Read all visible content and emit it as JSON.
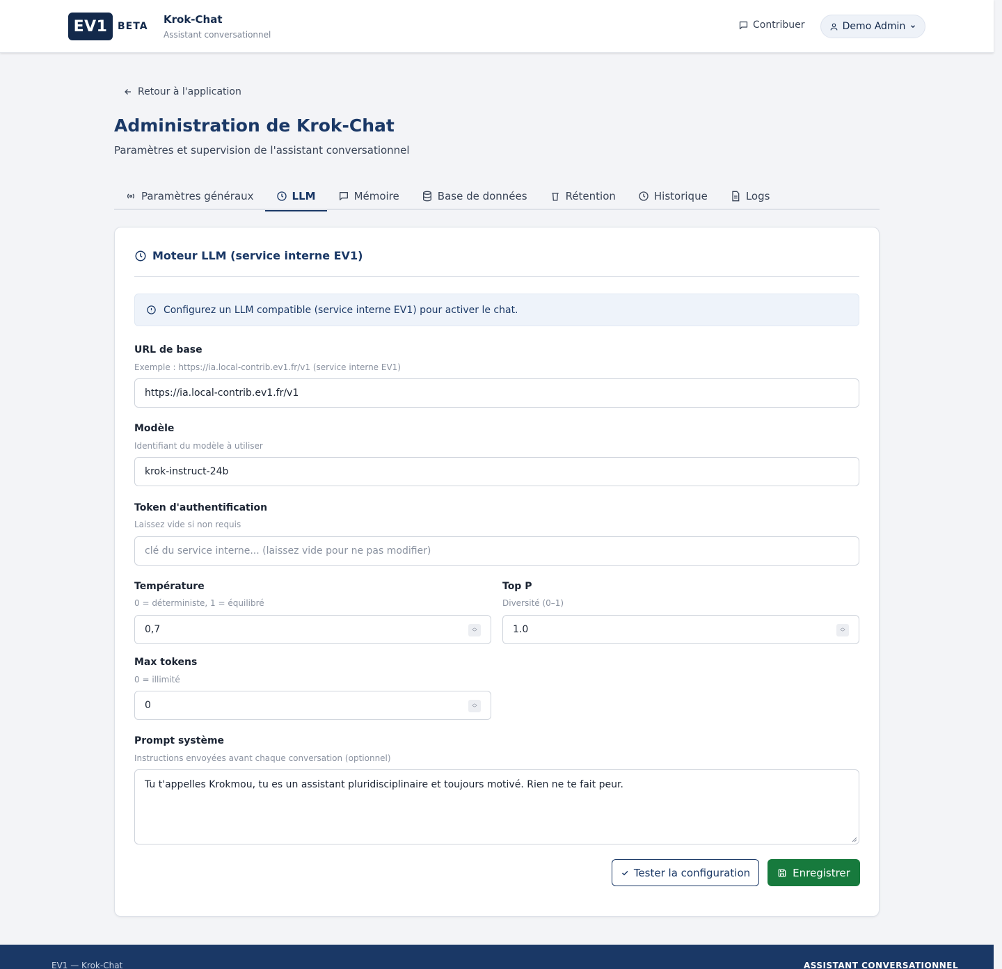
{
  "header": {
    "logo_text": "EV1",
    "beta_label": "BETA",
    "app_title": "Krok-Chat",
    "app_subtitle": "Assistant conversationnel",
    "contribute_label": "Contribuer",
    "user_name": "Demo Admin"
  },
  "page": {
    "back_label": "Retour à l'application",
    "title": "Administration de Krok-Chat",
    "subtitle": "Paramètres et supervision de l'assistant conversationnel"
  },
  "tabs": [
    {
      "label": "Paramètres généraux",
      "icon": "radio-icon",
      "active": false
    },
    {
      "label": "LLM",
      "icon": "clock-icon",
      "active": true
    },
    {
      "label": "Mémoire",
      "icon": "chat-icon",
      "active": false
    },
    {
      "label": "Base de données",
      "icon": "database-icon",
      "active": false
    },
    {
      "label": "Rétention",
      "icon": "trash-icon",
      "active": false
    },
    {
      "label": "Historique",
      "icon": "clock-icon",
      "active": false
    },
    {
      "label": "Logs",
      "icon": "file-icon",
      "active": false
    }
  ],
  "card": {
    "title": "Moteur LLM (service interne EV1)",
    "info": "Configurez un LLM compatible (service interne EV1) pour activer le chat."
  },
  "fields": {
    "base_url": {
      "label": "URL de base",
      "help": "Exemple : https://ia.local-contrib.ev1.fr/v1 (service interne EV1)",
      "value": "https://ia.local-contrib.ev1.fr/v1"
    },
    "model": {
      "label": "Modèle",
      "help": "Identifiant du modèle à utiliser",
      "value": "krok-instruct-24b"
    },
    "token": {
      "label": "Token d'authentification",
      "help": "Laissez vide si non requis",
      "value": "",
      "placeholder": "clé du service interne... (laissez vide pour ne pas modifier)"
    },
    "temperature": {
      "label": "Température",
      "help": "0 = déterministe, 1 = équilibré",
      "value": "0,7"
    },
    "top_p": {
      "label": "Top P",
      "help": "Diversité (0–1)",
      "value": "1.0"
    },
    "max_tokens": {
      "label": "Max tokens",
      "help": "0 = illimité",
      "value": "0"
    },
    "system_prompt": {
      "label": "Prompt système",
      "help": "Instructions envoyées avant chaque conversation (optionnel)",
      "value": "Tu t'appelles Krokmou, tu es un assistant pluridisciplinaire et toujours motivé. Rien ne te fait peur."
    }
  },
  "actions": {
    "test_label": "Tester la configuration",
    "save_label": "Enregistrer"
  },
  "footer": {
    "left": "EV1 — Krok-Chat",
    "right": "ASSISTANT CONVERSATIONNEL"
  },
  "colors": {
    "primary": "#1a3866",
    "brand_dark": "#13294b",
    "success": "#177a3d",
    "background": "#f3f4f7"
  }
}
